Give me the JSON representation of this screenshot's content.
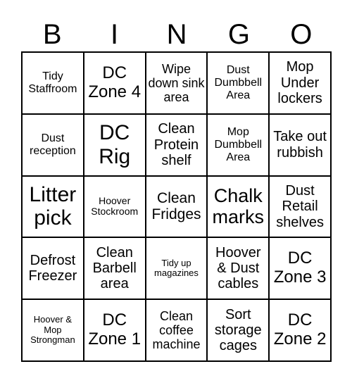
{
  "header": [
    "B",
    "I",
    "N",
    "G",
    "O"
  ],
  "cells": [
    {
      "text": "Tidy Staffroom",
      "size": 16
    },
    {
      "text": "DC Zone 4",
      "size": 24
    },
    {
      "text": "Wipe down sink area",
      "size": 18
    },
    {
      "text": "Dust Dumbbell Area",
      "size": 16
    },
    {
      "text": "Mop Under lockers",
      "size": 20
    },
    {
      "text": "Dust reception",
      "size": 16
    },
    {
      "text": "DC Rig",
      "size": 30
    },
    {
      "text": "Clean Protein shelf",
      "size": 20
    },
    {
      "text": "Mop Dumbbell Area",
      "size": 16
    },
    {
      "text": "Take out rubbish",
      "size": 20
    },
    {
      "text": "Litter pick",
      "size": 30
    },
    {
      "text": "Hoover Stockroom",
      "size": 14
    },
    {
      "text": "Clean Fridges",
      "size": 21
    },
    {
      "text": "Chalk marks",
      "size": 27
    },
    {
      "text": "Dust Retail shelves",
      "size": 20
    },
    {
      "text": "Defrost Freezer",
      "size": 20
    },
    {
      "text": "Clean Barbell area",
      "size": 20
    },
    {
      "text": "Tidy up magazines",
      "size": 13
    },
    {
      "text": "Hoover & Dust cables",
      "size": 20
    },
    {
      "text": "DC Zone 3",
      "size": 24
    },
    {
      "text": "Hoover & Mop Strongman",
      "size": 13
    },
    {
      "text": "DC Zone 1",
      "size": 24
    },
    {
      "text": "Clean coffee machine",
      "size": 18
    },
    {
      "text": "Sort storage cages",
      "size": 20
    },
    {
      "text": "DC Zone 2",
      "size": 24
    }
  ]
}
